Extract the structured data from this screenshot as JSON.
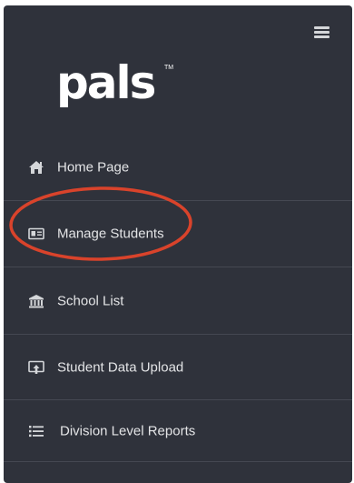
{
  "sidebar": {
    "menu_icon": "hamburger-menu-icon",
    "logo": {
      "text": "pals",
      "trademark": "TM"
    },
    "items": [
      {
        "label": "Home Page",
        "icon": "home-icon"
      },
      {
        "label": "Manage Students",
        "icon": "id-card-icon"
      },
      {
        "label": "School List",
        "icon": "institution-icon"
      },
      {
        "label": "Student Data Upload",
        "icon": "upload-icon"
      },
      {
        "label": "Division Level Reports",
        "icon": "list-icon"
      }
    ]
  },
  "colors": {
    "sidebar_bg": "#2f323b",
    "divider": "#454852",
    "text": "#e3e4e6",
    "annotation": "#d9432b"
  }
}
